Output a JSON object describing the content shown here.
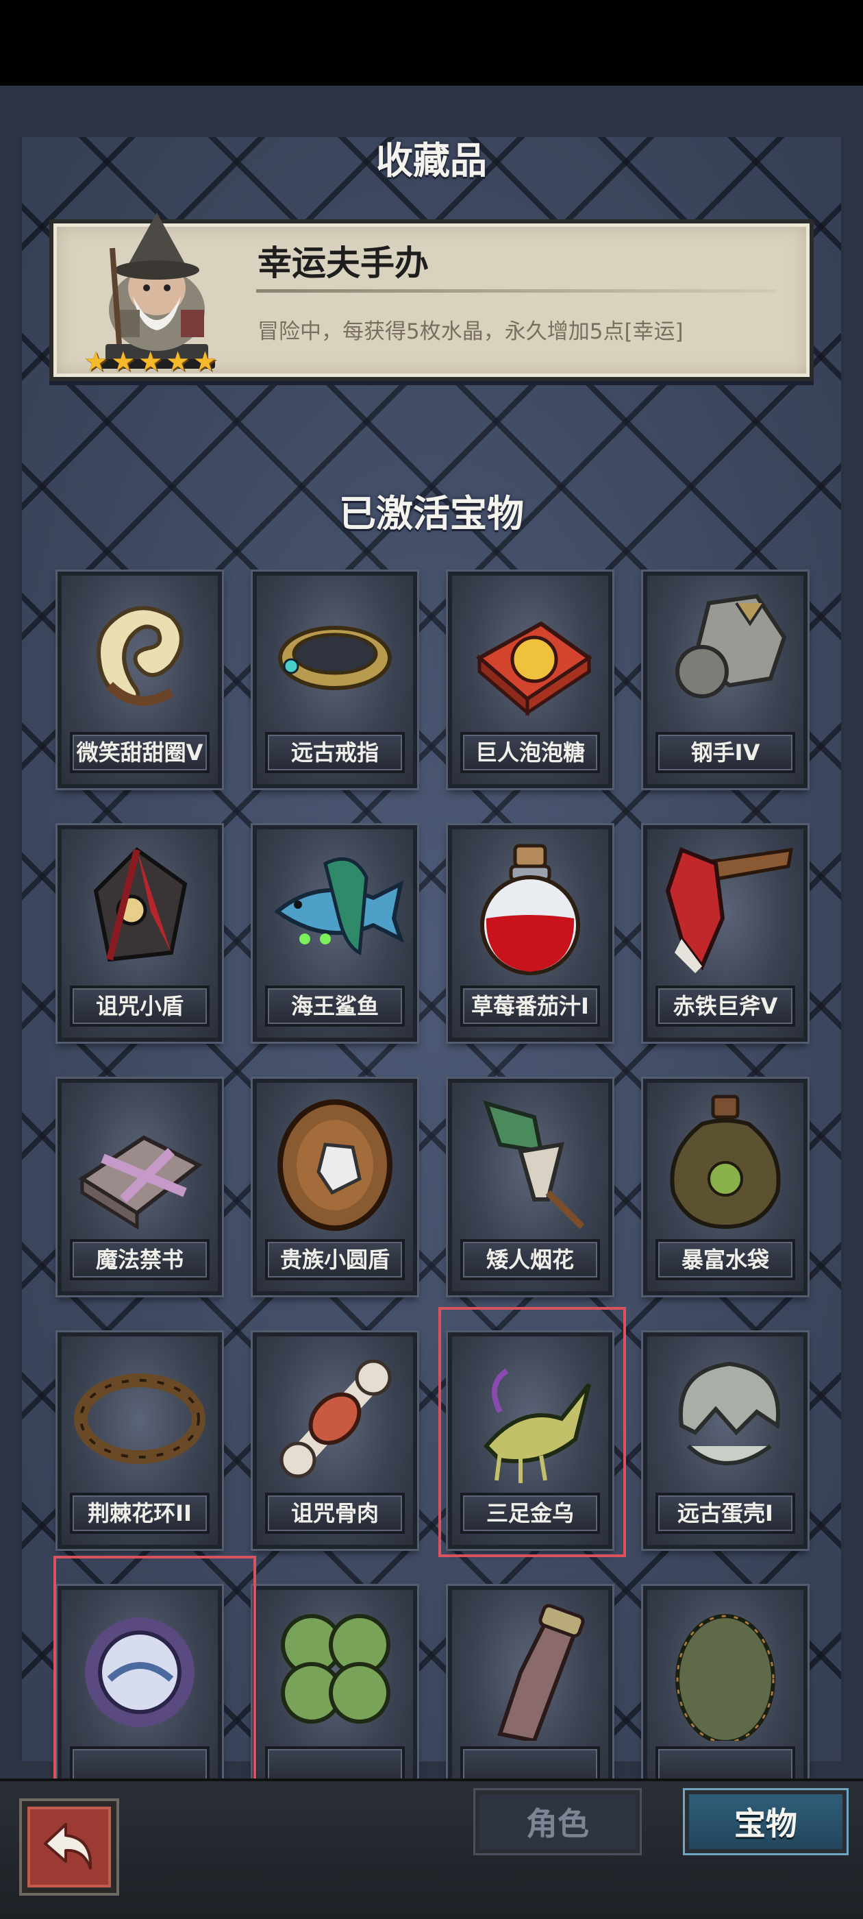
{
  "header": {
    "title": "收藏品"
  },
  "featured": {
    "name": "幸运夫手办",
    "description": "冒险中，每获得5枚水晶，永久增加5点[幸运]",
    "stars": 5,
    "star_glyph": "★"
  },
  "section": {
    "active_title": "已激活宝物"
  },
  "items": [
    {
      "label": "微笑甜甜圈V",
      "icon": "donut-icon"
    },
    {
      "label": "远古戒指",
      "icon": "ring-icon"
    },
    {
      "label": "巨人泡泡糖",
      "icon": "gum-box-icon"
    },
    {
      "label": "钢手IV",
      "icon": "steel-gauntlet-icon"
    },
    {
      "label": "诅咒小盾",
      "icon": "cursed-shield-icon"
    },
    {
      "label": "海王鲨鱼",
      "icon": "shark-icon"
    },
    {
      "label": "草莓番茄汁I",
      "icon": "potion-flask-icon"
    },
    {
      "label": "赤铁巨斧V",
      "icon": "axe-icon"
    },
    {
      "label": "魔法禁书",
      "icon": "forbidden-book-icon"
    },
    {
      "label": "贵族小圆盾",
      "icon": "round-shield-icon"
    },
    {
      "label": "矮人烟花",
      "icon": "firework-icon"
    },
    {
      "label": "暴富水袋",
      "icon": "water-pouch-icon"
    },
    {
      "label": "荆棘花环II",
      "icon": "thorn-wreath-icon"
    },
    {
      "label": "诅咒骨肉",
      "icon": "bone-meat-icon"
    },
    {
      "label": "三足金乌",
      "icon": "golden-crow-icon"
    },
    {
      "label": "远古蛋壳I",
      "icon": "eggshell-icon"
    },
    {
      "label": "",
      "icon": "crystal-orb-icon"
    },
    {
      "label": "",
      "icon": "clover-icon"
    },
    {
      "label": "",
      "icon": "giant-finger-icon"
    },
    {
      "label": "",
      "icon": "dragon-egg-icon"
    }
  ],
  "tabs": {
    "role": "角色",
    "treasure": "宝物"
  },
  "colors": {
    "highlight": "#d9525e",
    "star": "#f6b92c",
    "active_tab": "#2f5d78"
  }
}
